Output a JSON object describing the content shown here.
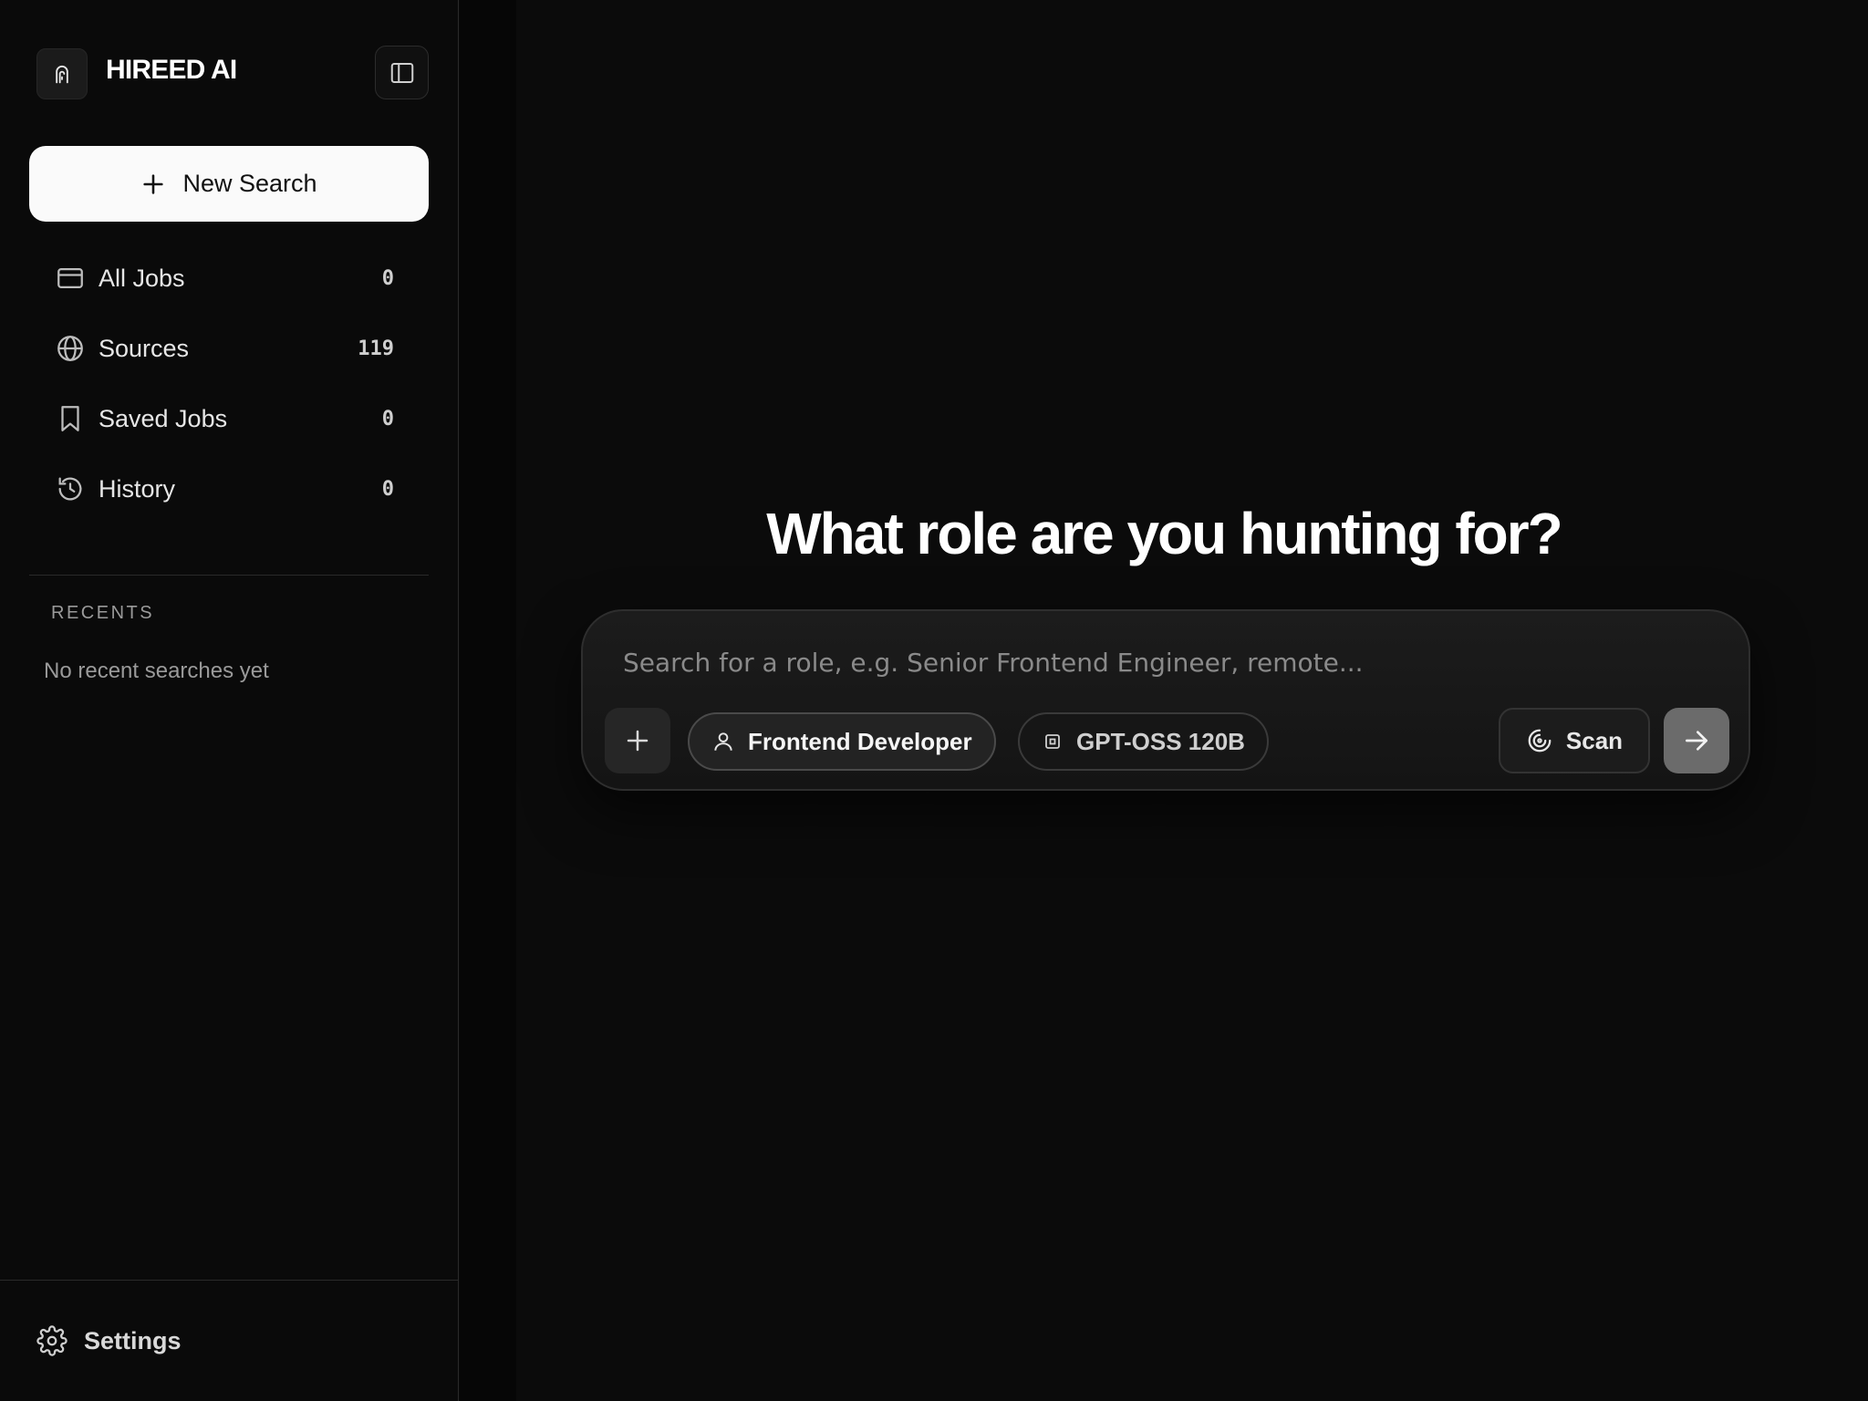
{
  "brand": {
    "name": "HIREED AI",
    "logo_icon": "fingerprint-ghost-icon"
  },
  "sidebar": {
    "new_search_label": "New Search",
    "nav": [
      {
        "label": "All Jobs",
        "count": "0",
        "icon": "window-icon"
      },
      {
        "label": "Sources",
        "count": "119",
        "icon": "globe-icon"
      },
      {
        "label": "Saved Jobs",
        "count": "0",
        "icon": "bookmark-icon"
      },
      {
        "label": "History",
        "count": "0",
        "icon": "history-icon"
      }
    ],
    "recents_heading": "RECENTS",
    "recents_empty": "No recent searches yet",
    "settings_label": "Settings"
  },
  "main": {
    "title": "What role are you hunting for?",
    "search": {
      "placeholder": "Search for a role, e.g. Senior Frontend Engineer, remote...",
      "value": ""
    },
    "role_chip": "Frontend Developer",
    "model_chip": "GPT-OSS 120B",
    "scan_label": "Scan"
  },
  "colors": {
    "background": "#0a0a0a",
    "primary_button": "#fafafa",
    "send_button": "#6b6b6b"
  }
}
